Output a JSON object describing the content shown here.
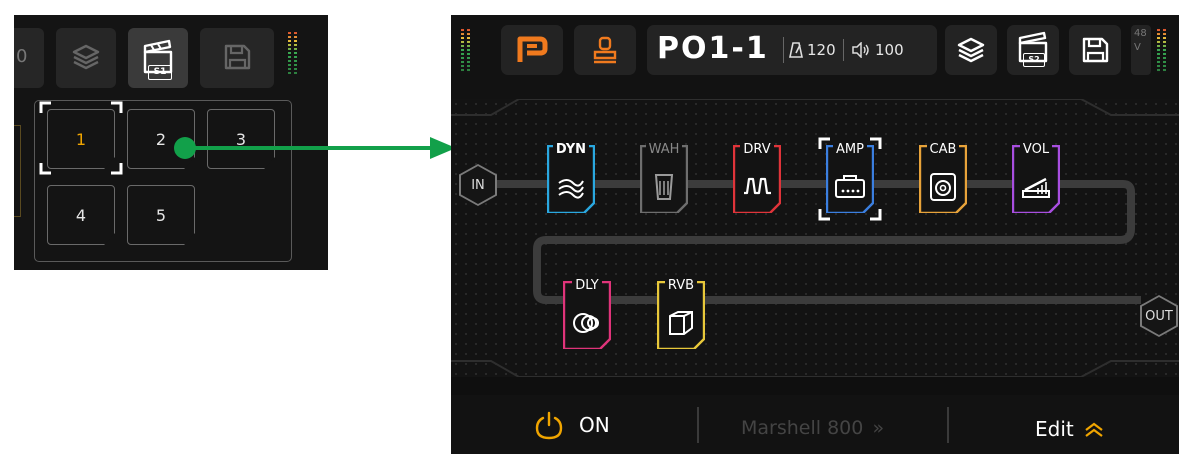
{
  "inset": {
    "left_partial_label": "0",
    "scene_badge": "S1",
    "scenes": [
      "1",
      "2",
      "3",
      "4",
      "5"
    ],
    "active_scene": "1"
  },
  "device": {
    "preset_name": "PO1-1",
    "bpm": "120",
    "volume": "100",
    "scene_badge": "S2",
    "phantom_label": "48V",
    "in_label": "IN",
    "out_label": "OUT",
    "chain_row1": [
      {
        "label": "DYN",
        "color": "#2aa8e0",
        "bypassed": false,
        "selected": false,
        "icon": "dynamics-icon"
      },
      {
        "label": "WAH",
        "color": "#6e6e6e",
        "bypassed": true,
        "selected": false,
        "icon": "wah-pedal-icon"
      },
      {
        "label": "DRV",
        "color": "#e0343a",
        "bypassed": false,
        "selected": false,
        "icon": "drive-wave-icon"
      },
      {
        "label": "AMP",
        "color": "#3b7fe0",
        "bypassed": false,
        "selected": true,
        "icon": "amp-head-icon"
      },
      {
        "label": "CAB",
        "color": "#e8a33a",
        "bypassed": false,
        "selected": false,
        "icon": "cabinet-icon"
      },
      {
        "label": "VOL",
        "color": "#a84ee0",
        "bypassed": false,
        "selected": false,
        "icon": "volume-pedal-icon"
      }
    ],
    "chain_row2": [
      {
        "label": "DLY",
        "color": "#e0347a",
        "bypassed": false,
        "selected": false,
        "icon": "delay-icon"
      },
      {
        "label": "RVB",
        "color": "#e8c83a",
        "bypassed": false,
        "selected": false,
        "icon": "reverb-cube-icon"
      }
    ],
    "bottom": {
      "power_label": "ON",
      "model_label": "Marshell 800",
      "model_chevron": "»",
      "edit_label": "Edit"
    },
    "colors": {
      "accent_orange": "#f07a1e",
      "power_color": "#f0a500",
      "arrow_green": "#12a04a"
    }
  }
}
